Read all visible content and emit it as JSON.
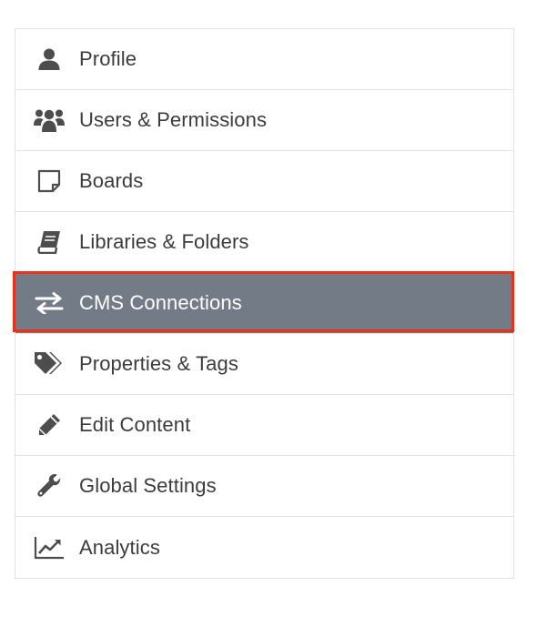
{
  "menu": {
    "items": [
      {
        "label": "Profile",
        "icon": "user-icon"
      },
      {
        "label": "Users & Permissions",
        "icon": "users-icon"
      },
      {
        "label": "Boards",
        "icon": "sticky-note-icon"
      },
      {
        "label": "Libraries & Folders",
        "icon": "book-icon"
      },
      {
        "label": "CMS Connections",
        "icon": "exchange-icon",
        "active": true
      },
      {
        "label": "Properties & Tags",
        "icon": "tags-icon"
      },
      {
        "label": "Edit Content",
        "icon": "pencil-icon"
      },
      {
        "label": "Global Settings",
        "icon": "wrench-icon"
      },
      {
        "label": "Analytics",
        "icon": "line-chart-icon"
      }
    ]
  },
  "colors": {
    "active_background": "#737b86",
    "highlight_border": "#e8321c",
    "text": "#3c3c3c",
    "divider": "#e2e2e2"
  }
}
